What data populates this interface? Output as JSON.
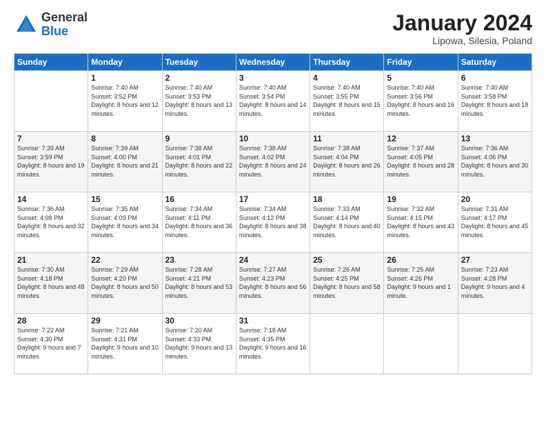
{
  "logo": {
    "general": "General",
    "blue": "Blue"
  },
  "header": {
    "month": "January 2024",
    "location": "Lipowa, Silesia, Poland"
  },
  "days_of_week": [
    "Sunday",
    "Monday",
    "Tuesday",
    "Wednesday",
    "Thursday",
    "Friday",
    "Saturday"
  ],
  "weeks": [
    [
      {
        "day": "",
        "sunrise": "",
        "sunset": "",
        "daylight": ""
      },
      {
        "day": "1",
        "sunrise": "Sunrise: 7:40 AM",
        "sunset": "Sunset: 3:52 PM",
        "daylight": "Daylight: 8 hours and 12 minutes."
      },
      {
        "day": "2",
        "sunrise": "Sunrise: 7:40 AM",
        "sunset": "Sunset: 3:53 PM",
        "daylight": "Daylight: 8 hours and 13 minutes."
      },
      {
        "day": "3",
        "sunrise": "Sunrise: 7:40 AM",
        "sunset": "Sunset: 3:54 PM",
        "daylight": "Daylight: 8 hours and 14 minutes."
      },
      {
        "day": "4",
        "sunrise": "Sunrise: 7:40 AM",
        "sunset": "Sunset: 3:55 PM",
        "daylight": "Daylight: 8 hours and 15 minutes."
      },
      {
        "day": "5",
        "sunrise": "Sunrise: 7:40 AM",
        "sunset": "Sunset: 3:56 PM",
        "daylight": "Daylight: 8 hours and 16 minutes."
      },
      {
        "day": "6",
        "sunrise": "Sunrise: 7:40 AM",
        "sunset": "Sunset: 3:58 PM",
        "daylight": "Daylight: 8 hours and 18 minutes."
      }
    ],
    [
      {
        "day": "7",
        "sunrise": "Sunrise: 7:39 AM",
        "sunset": "Sunset: 3:59 PM",
        "daylight": "Daylight: 8 hours and 19 minutes."
      },
      {
        "day": "8",
        "sunrise": "Sunrise: 7:39 AM",
        "sunset": "Sunset: 4:00 PM",
        "daylight": "Daylight: 8 hours and 21 minutes."
      },
      {
        "day": "9",
        "sunrise": "Sunrise: 7:38 AM",
        "sunset": "Sunset: 4:01 PM",
        "daylight": "Daylight: 8 hours and 22 minutes."
      },
      {
        "day": "10",
        "sunrise": "Sunrise: 7:38 AM",
        "sunset": "Sunset: 4:02 PM",
        "daylight": "Daylight: 8 hours and 24 minutes."
      },
      {
        "day": "11",
        "sunrise": "Sunrise: 7:38 AM",
        "sunset": "Sunset: 4:04 PM",
        "daylight": "Daylight: 8 hours and 26 minutes."
      },
      {
        "day": "12",
        "sunrise": "Sunrise: 7:37 AM",
        "sunset": "Sunset: 4:05 PM",
        "daylight": "Daylight: 8 hours and 28 minutes."
      },
      {
        "day": "13",
        "sunrise": "Sunrise: 7:36 AM",
        "sunset": "Sunset: 4:06 PM",
        "daylight": "Daylight: 8 hours and 30 minutes."
      }
    ],
    [
      {
        "day": "14",
        "sunrise": "Sunrise: 7:36 AM",
        "sunset": "Sunset: 4:08 PM",
        "daylight": "Daylight: 8 hours and 32 minutes."
      },
      {
        "day": "15",
        "sunrise": "Sunrise: 7:35 AM",
        "sunset": "Sunset: 4:09 PM",
        "daylight": "Daylight: 8 hours and 34 minutes."
      },
      {
        "day": "16",
        "sunrise": "Sunrise: 7:34 AM",
        "sunset": "Sunset: 4:11 PM",
        "daylight": "Daylight: 8 hours and 36 minutes."
      },
      {
        "day": "17",
        "sunrise": "Sunrise: 7:34 AM",
        "sunset": "Sunset: 4:12 PM",
        "daylight": "Daylight: 8 hours and 38 minutes."
      },
      {
        "day": "18",
        "sunrise": "Sunrise: 7:33 AM",
        "sunset": "Sunset: 4:14 PM",
        "daylight": "Daylight: 8 hours and 40 minutes."
      },
      {
        "day": "19",
        "sunrise": "Sunrise: 7:32 AM",
        "sunset": "Sunset: 4:15 PM",
        "daylight": "Daylight: 8 hours and 43 minutes."
      },
      {
        "day": "20",
        "sunrise": "Sunrise: 7:31 AM",
        "sunset": "Sunset: 4:17 PM",
        "daylight": "Daylight: 8 hours and 45 minutes."
      }
    ],
    [
      {
        "day": "21",
        "sunrise": "Sunrise: 7:30 AM",
        "sunset": "Sunset: 4:18 PM",
        "daylight": "Daylight: 8 hours and 48 minutes."
      },
      {
        "day": "22",
        "sunrise": "Sunrise: 7:29 AM",
        "sunset": "Sunset: 4:20 PM",
        "daylight": "Daylight: 8 hours and 50 minutes."
      },
      {
        "day": "23",
        "sunrise": "Sunrise: 7:28 AM",
        "sunset": "Sunset: 4:21 PM",
        "daylight": "Daylight: 8 hours and 53 minutes."
      },
      {
        "day": "24",
        "sunrise": "Sunrise: 7:27 AM",
        "sunset": "Sunset: 4:23 PM",
        "daylight": "Daylight: 8 hours and 56 minutes."
      },
      {
        "day": "25",
        "sunrise": "Sunrise: 7:26 AM",
        "sunset": "Sunset: 4:25 PM",
        "daylight": "Daylight: 8 hours and 58 minutes."
      },
      {
        "day": "26",
        "sunrise": "Sunrise: 7:25 AM",
        "sunset": "Sunset: 4:26 PM",
        "daylight": "Daylight: 9 hours and 1 minute."
      },
      {
        "day": "27",
        "sunrise": "Sunrise: 7:23 AM",
        "sunset": "Sunset: 4:28 PM",
        "daylight": "Daylight: 9 hours and 4 minutes."
      }
    ],
    [
      {
        "day": "28",
        "sunrise": "Sunrise: 7:22 AM",
        "sunset": "Sunset: 4:30 PM",
        "daylight": "Daylight: 9 hours and 7 minutes."
      },
      {
        "day": "29",
        "sunrise": "Sunrise: 7:21 AM",
        "sunset": "Sunset: 4:31 PM",
        "daylight": "Daylight: 9 hours and 10 minutes."
      },
      {
        "day": "30",
        "sunrise": "Sunrise: 7:20 AM",
        "sunset": "Sunset: 4:33 PM",
        "daylight": "Daylight: 9 hours and 13 minutes."
      },
      {
        "day": "31",
        "sunrise": "Sunrise: 7:18 AM",
        "sunset": "Sunset: 4:35 PM",
        "daylight": "Daylight: 9 hours and 16 minutes."
      },
      {
        "day": "",
        "sunrise": "",
        "sunset": "",
        "daylight": ""
      },
      {
        "day": "",
        "sunrise": "",
        "sunset": "",
        "daylight": ""
      },
      {
        "day": "",
        "sunrise": "",
        "sunset": "",
        "daylight": ""
      }
    ]
  ]
}
